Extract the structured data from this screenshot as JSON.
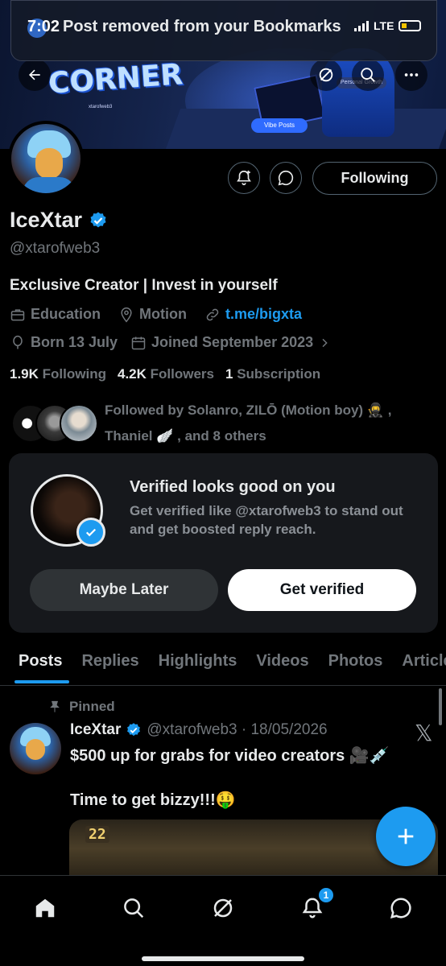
{
  "status_bar": {
    "time": "7:02",
    "network": "LTE"
  },
  "toast": {
    "message": "Post removed from your Bookmarks"
  },
  "banner": {
    "logo_text": "CORNER",
    "logo_tag": "xtarofweb3",
    "vibe_posts": "Vibe Posts",
    "personal": "Personal Growth"
  },
  "profile": {
    "name": "IceXtar",
    "handle": "@xtarofweb3",
    "bio": "Exclusive Creator | Invest in yourself",
    "category": "Education",
    "location": "Motion",
    "link": "t.me/bigxta",
    "birthday": "Born 13 July",
    "joined": "Joined September 2023",
    "following_button": "Following"
  },
  "stats": {
    "following_count": "1.9K",
    "following_label": "Following",
    "followers_count": "4.2K",
    "followers_label": "Followers",
    "subscription_count": "1",
    "subscription_label": "Subscription"
  },
  "followed_by": {
    "text": "Followed by Solanro, ZILŌ (Motion boy) 🥷 , Thaniel 🪽 , and 8 others"
  },
  "verify_card": {
    "title": "Verified looks good on you",
    "description": "Get verified like @xtarofweb3 to stand out and get boosted reply reach.",
    "maybe_later": "Maybe Later",
    "get_verified": "Get verified"
  },
  "tabs": [
    "Posts",
    "Replies",
    "Highlights",
    "Videos",
    "Photos",
    "Articles"
  ],
  "post": {
    "pinned_label": "Pinned",
    "author": "IceXtar",
    "handle_date": "@xtarofweb3 · 18/05/2026",
    "line1": "$500 up for grabs for video creators 🎥💉",
    "line2": "Time to get bizzy!!!🤑",
    "media_text": "22"
  },
  "bottom_nav": {
    "notification_count": "1"
  },
  "colors": {
    "accent": "#1d9bf0",
    "background": "#000000",
    "muted": "#71767b"
  }
}
